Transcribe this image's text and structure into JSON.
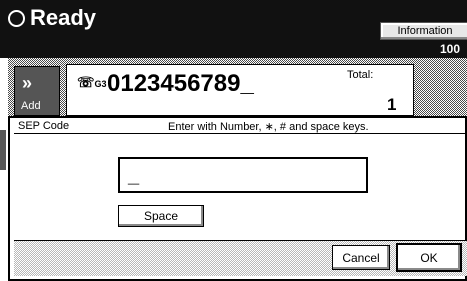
{
  "status": {
    "title": "Ready",
    "info_label": "Information",
    "percent_partial": "100"
  },
  "fax": {
    "add_label": "Add",
    "number": "0123456789_",
    "total_label": "Total:",
    "total_value": "1"
  },
  "dialog": {
    "title": "SEP Code",
    "instruction": "Enter with Number, ∗, # and space keys.",
    "input_value": "_",
    "space_label": "Space",
    "cancel_label": "Cancel",
    "ok_label": "OK"
  }
}
